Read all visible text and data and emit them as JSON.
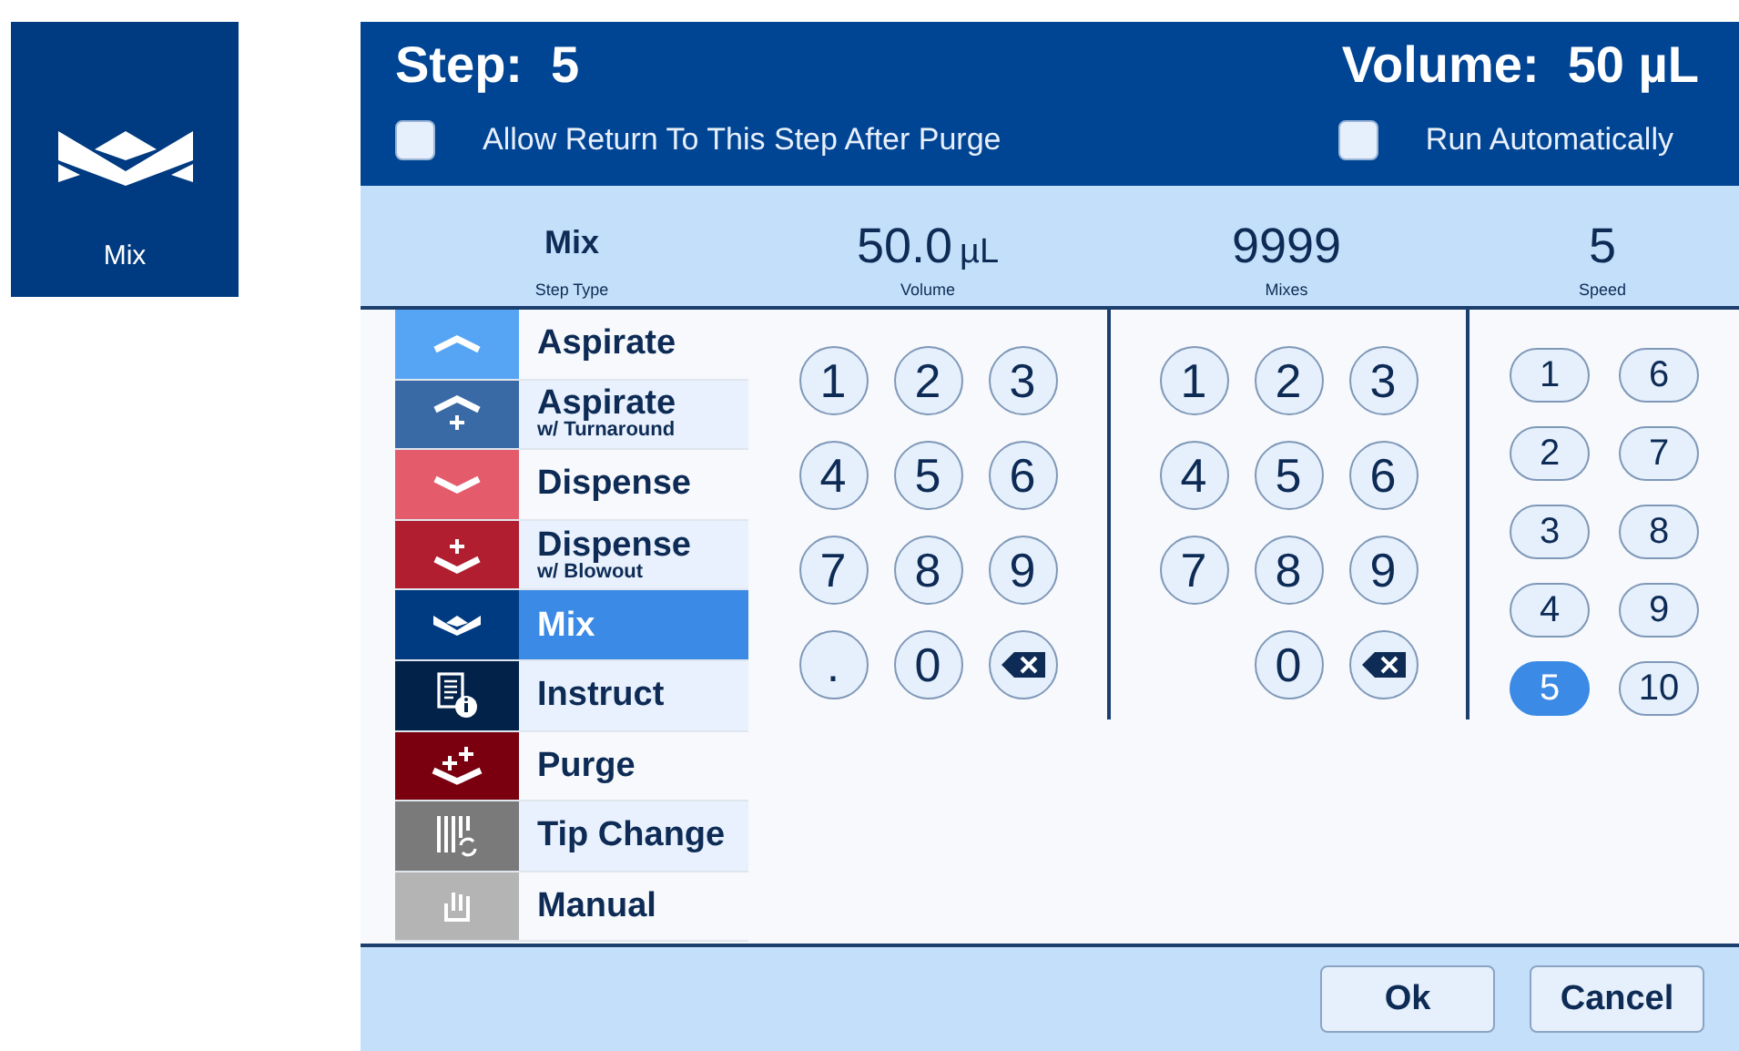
{
  "tile": {
    "label": "Mix"
  },
  "header": {
    "step": "Step:  5",
    "volume": "Volume:  50 µL"
  },
  "options": [
    {
      "label": "Allow Return To This Step After Purge",
      "checked": false
    },
    {
      "label": "Run Automatically",
      "checked": false
    }
  ],
  "summary": [
    {
      "value": "Mix",
      "caption": "Step Type",
      "kind": "text"
    },
    {
      "value": "50.0",
      "unit": "µL",
      "caption": "Volume",
      "kind": "number"
    },
    {
      "value": "9999",
      "caption": "Mixes",
      "kind": "number"
    },
    {
      "value": "5",
      "caption": "Speed",
      "kind": "number"
    }
  ],
  "step_types": [
    {
      "name": "Aspirate",
      "kind": "aspirate",
      "color": "#56a5f5",
      "selected": false
    },
    {
      "name": "Aspirate",
      "subtitle": "w/ Turnaround",
      "kind": "aspirate-turnaround",
      "color": "#3a6aa6",
      "selected": false
    },
    {
      "name": "Dispense",
      "kind": "dispense",
      "color": "#e45c6c",
      "selected": false
    },
    {
      "name": "Dispense",
      "subtitle": "w/ Blowout",
      "kind": "dispense-blowout",
      "color": "#b01e30",
      "selected": false
    },
    {
      "name": "Mix",
      "kind": "mix",
      "color": "#003a80",
      "selected": true
    },
    {
      "name": "Instruct",
      "kind": "instruct",
      "color": "#03224a",
      "selected": false
    },
    {
      "name": "Purge",
      "kind": "purge",
      "color": "#7a0010",
      "selected": false
    },
    {
      "name": "Tip Change",
      "kind": "tip-change",
      "color": "#7a7a7a",
      "selected": false
    },
    {
      "name": "Manual",
      "kind": "manual",
      "color": "#b4b4b4",
      "selected": false
    }
  ],
  "volume_keypad": [
    {
      "kind": "digit",
      "label": "1"
    },
    {
      "kind": "digit",
      "label": "2"
    },
    {
      "kind": "digit",
      "label": "3"
    },
    {
      "kind": "digit",
      "label": "4"
    },
    {
      "kind": "digit",
      "label": "5"
    },
    {
      "kind": "digit",
      "label": "6"
    },
    {
      "kind": "digit",
      "label": "7"
    },
    {
      "kind": "digit",
      "label": "8"
    },
    {
      "kind": "digit",
      "label": "9"
    },
    {
      "kind": "digit",
      "label": "."
    },
    {
      "kind": "digit",
      "label": "0"
    },
    {
      "kind": "backspace"
    }
  ],
  "mixes_keypad": [
    {
      "kind": "digit",
      "label": "1"
    },
    {
      "kind": "digit",
      "label": "2"
    },
    {
      "kind": "digit",
      "label": "3"
    },
    {
      "kind": "digit",
      "label": "4"
    },
    {
      "kind": "digit",
      "label": "5"
    },
    {
      "kind": "digit",
      "label": "6"
    },
    {
      "kind": "digit",
      "label": "7"
    },
    {
      "kind": "digit",
      "label": "8"
    },
    {
      "kind": "digit",
      "label": "9"
    },
    {
      "kind": "empty"
    },
    {
      "kind": "digit",
      "label": "0"
    },
    {
      "kind": "backspace"
    }
  ],
  "speeds": [
    {
      "label": "1",
      "selected": false
    },
    {
      "label": "2",
      "selected": false
    },
    {
      "label": "3",
      "selected": false
    },
    {
      "label": "4",
      "selected": false
    },
    {
      "label": "5",
      "selected": true
    },
    {
      "label": "6",
      "selected": false
    },
    {
      "label": "7",
      "selected": false
    },
    {
      "label": "8",
      "selected": false
    },
    {
      "label": "9",
      "selected": false
    },
    {
      "label": "10",
      "selected": false
    }
  ],
  "buttons": [
    "Ok",
    "Cancel"
  ]
}
